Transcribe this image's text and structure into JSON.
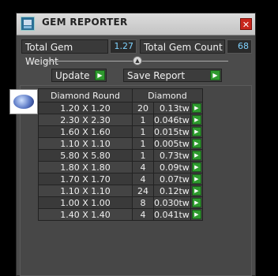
{
  "window": {
    "title": "GEM REPORTER",
    "close_glyph": "✕"
  },
  "totals": {
    "weight_label": "Total Gem Weight",
    "weight_value": "1.27",
    "count_label": "Total Gem Count",
    "count_value": "68"
  },
  "splitter_glyph": "▲",
  "buttons": {
    "update": "Update",
    "save_report": "Save Report",
    "go_glyph": "▶"
  },
  "table": {
    "headers": [
      "Diamond Round",
      "Diamond"
    ],
    "rows": [
      {
        "size": "1.20 X 1.20",
        "count": "20",
        "tw": "0.13tw"
      },
      {
        "size": "2.30 X 2.30",
        "count": "1",
        "tw": "0.046tw"
      },
      {
        "size": "1.60 X 1.60",
        "count": "1",
        "tw": "0.015tw"
      },
      {
        "size": "1.10 X 1.10",
        "count": "1",
        "tw": "0.005tw"
      },
      {
        "size": "5.80 X 5.80",
        "count": "1",
        "tw": "0.73tw"
      },
      {
        "size": "1.80 X 1.80",
        "count": "4",
        "tw": "0.09tw"
      },
      {
        "size": "1.70 X 1.70",
        "count": "4",
        "tw": "0.07tw"
      },
      {
        "size": "1.10 X 1.10",
        "count": "24",
        "tw": "0.12tw"
      },
      {
        "size": "1.00 X 1.00",
        "count": "8",
        "tw": "0.030tw"
      },
      {
        "size": "1.40 X 1.40",
        "count": "4",
        "tw": "0.041tw"
      }
    ]
  },
  "icons": {
    "app": "gem-reporter-app-icon",
    "thumbnail": "round-diamond-icon"
  }
}
